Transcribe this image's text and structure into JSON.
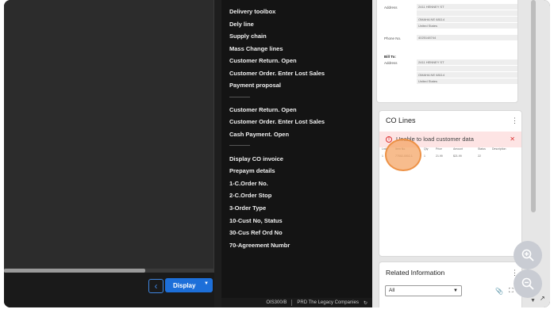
{
  "menu": {
    "items": [
      "Delivery toolbox",
      "Dely line",
      "Supply chain",
      "Mass Change lines",
      "Customer Return. Open",
      "Customer Order. Enter Lost Sales",
      "Payment proposal",
      "Customer Return. Open",
      "Customer Order. Enter Lost Sales",
      "Cash Payment. Open",
      "Display CO invoice",
      "Prepaym details",
      "1-C.Order No.",
      "2-C.Order Stop",
      "3-Order Type",
      "10-Cust No, Status",
      "30-Cus Ref Ord No",
      "70-Agreement Numbr"
    ]
  },
  "toolbar": {
    "display_label": "Display"
  },
  "status_bar": {
    "program": "OIS300/B",
    "environment": "PRD The Legacy Companies"
  },
  "address_card": {
    "address_label": "Address",
    "phone_label": "Phone No.",
    "bill_to_label": "Bill To:",
    "bill_address_label": "Address",
    "ship_line1": "2411 HENNEY ST",
    "ship_line2": "",
    "ship_line3": "OMAHA NE 68114",
    "ship_country": "United States",
    "phone": "4025148744",
    "bill_line1": "2411 HENNEY ST",
    "bill_line2": "",
    "bill_line3": "OMAHA NE 68114",
    "bill_country": "United States"
  },
  "co_lines": {
    "title": "CO Lines",
    "error_text": "Unable to load customer data",
    "columns": [
      "Ln#",
      "Item No.",
      "Qty",
      "Price",
      "Amount",
      "Status",
      "Description"
    ],
    "row": [
      "1",
      "77002-0002-1",
      "1",
      "21.99",
      "$21.99",
      "22",
      ""
    ]
  },
  "related": {
    "title": "Related Information",
    "select_value": "All"
  },
  "icons": {
    "back": "chevron-left-icon",
    "dropdown": "caret-down-icon",
    "error": "error-circle-icon",
    "close": "close-icon",
    "kebab": "kebab-menu-icon",
    "paperclip": "paperclip-icon",
    "expand": "expand-icon",
    "zoom_in": "zoom-in-icon",
    "zoom_out": "zoom-out-icon",
    "external": "external-link-icon"
  },
  "colors": {
    "primary_button": "#1d6fd9",
    "error_bg": "#fde4e4",
    "error_icon": "#dd3333",
    "highlight": "#f4a261"
  }
}
